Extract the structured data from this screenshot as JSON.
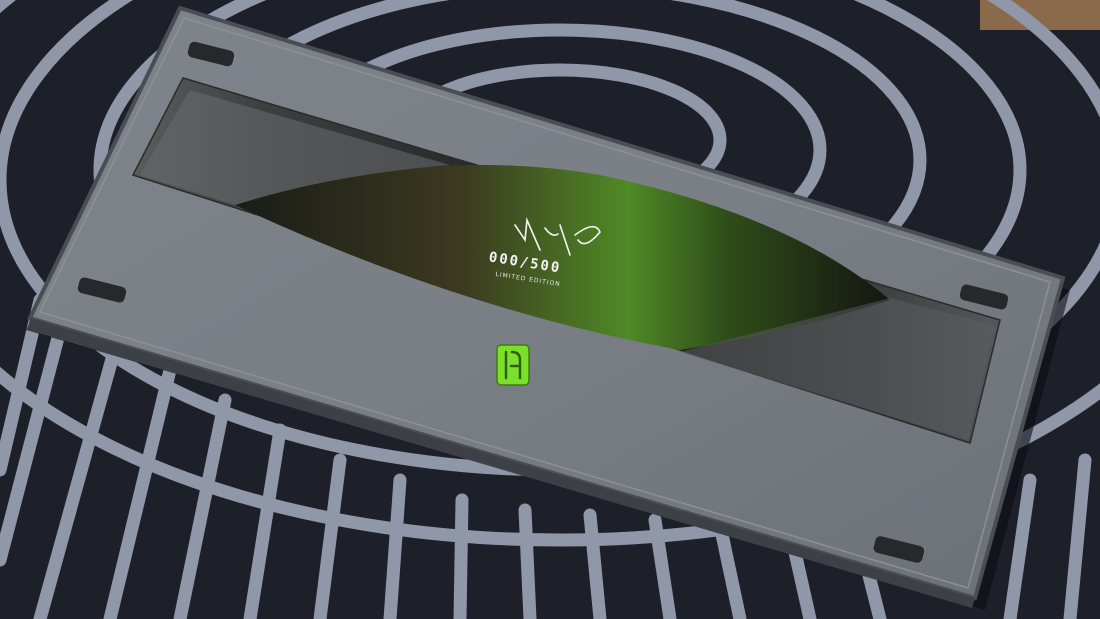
{
  "serial_text": "000/500",
  "edition_text": "LIMITED EDITION",
  "colors": {
    "mat_dark": "#1d2029",
    "mat_stripe": "#8f97a8",
    "case": "#767b82",
    "case_edge": "#4a4e54",
    "weight_plate": "#3a3c3f",
    "accent_green": "#7be02a"
  }
}
